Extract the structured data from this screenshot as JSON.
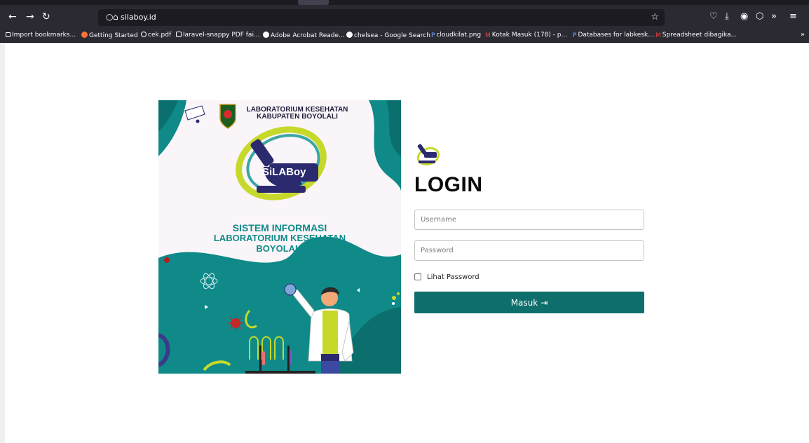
{
  "browser": {
    "url": "silaboy.id",
    "bookmarks": [
      {
        "label": "Import bookmarks...",
        "icon": "import-icon",
        "color": "#fbfbfe"
      },
      {
        "label": "Getting Started",
        "icon": "firefox-icon",
        "color": "#ff7139"
      },
      {
        "label": "cek.pdf",
        "icon": "globe-icon",
        "color": "#fbfbfe"
      },
      {
        "label": "laravel-snappy PDF fai...",
        "icon": "github-icon",
        "color": "#fbfbfe"
      },
      {
        "label": "Adobe Acrobat Reade...",
        "icon": "google-icon",
        "color": "#fbfbfe"
      },
      {
        "label": "chelsea - Google Search",
        "icon": "google-icon",
        "color": "#fbfbfe"
      },
      {
        "label": "cloudkilat.png",
        "icon": "p-icon",
        "color": "#6aa6ff"
      },
      {
        "label": "Kotak Masuk (178) - p...",
        "icon": "gmail-icon",
        "color": "#ea4335"
      },
      {
        "label": "Databases for labkesk...",
        "icon": "p-icon",
        "color": "#6aa6ff"
      },
      {
        "label": "Spreadsheet dibagika...",
        "icon": "gmail-icon",
        "color": "#ea4335"
      }
    ]
  },
  "poster": {
    "header_line1": "LABORATORIUM KESEHATAN",
    "header_line2": "KABUPATEN BOYOLALI",
    "logo_text": "SiLABoy",
    "title_line1": "SISTEM INFORMASI",
    "title_line2": "LABORATORIUM KESEHATAN",
    "title_line3": "BOYOLALI",
    "colors": {
      "teal": "#0f8a89",
      "dark_teal": "#0b6f6e",
      "navy": "#2b2a6e",
      "lime": "#c6d92b"
    }
  },
  "login": {
    "title": "LOGIN",
    "username_placeholder": "Username",
    "password_placeholder": "Password",
    "show_password_label": "Lihat Password",
    "submit_label": "Masuk",
    "submit_color": "#0e6e6c"
  }
}
